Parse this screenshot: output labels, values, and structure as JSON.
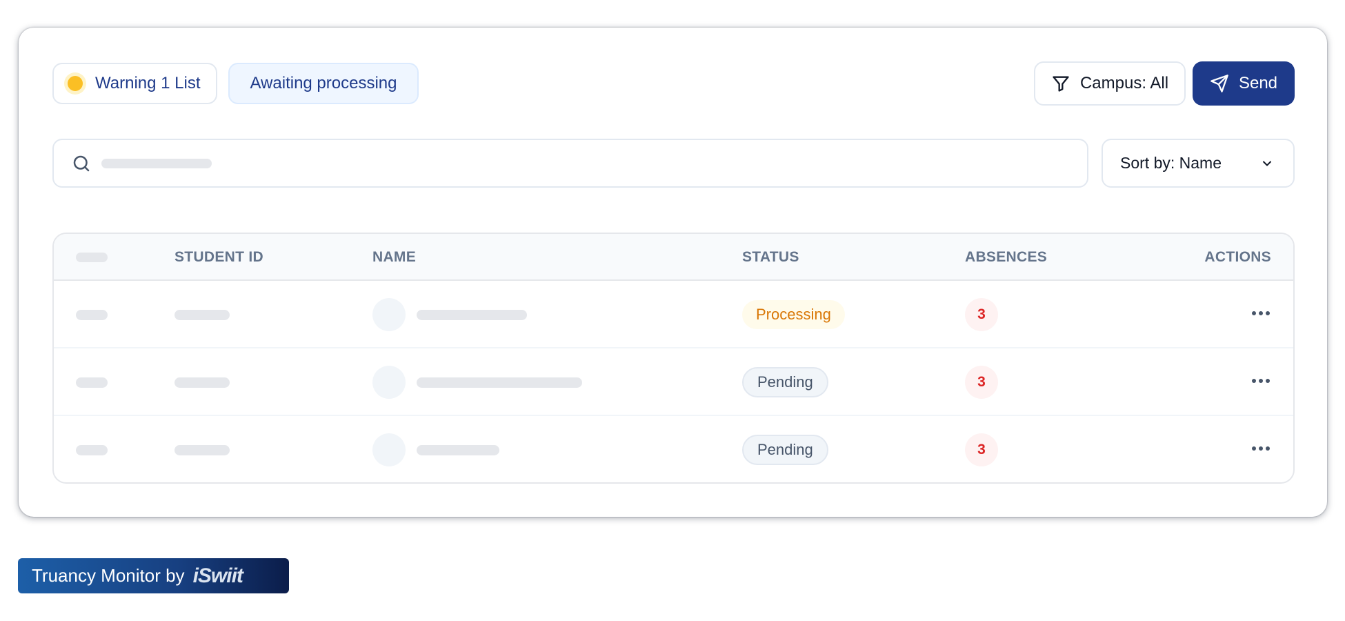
{
  "header": {
    "warning_chip": "Warning 1 List",
    "awaiting_chip": "Awaiting processing",
    "campus_button": "Campus: All",
    "send_button": "Send"
  },
  "search": {
    "placeholder": ""
  },
  "sort": {
    "label": "Sort by: Name"
  },
  "table": {
    "columns": {
      "student_id": "STUDENT ID",
      "name": "NAME",
      "status": "STATUS",
      "absences": "ABSENCES",
      "actions": "ACTIONS"
    },
    "rows": [
      {
        "status": "Processing",
        "absences": "3"
      },
      {
        "status": "Pending",
        "absences": "3"
      },
      {
        "status": "Pending",
        "absences": "3"
      }
    ]
  },
  "footer": {
    "brand_text": "Truancy Monitor by",
    "brand_logo": "iSwiit"
  },
  "colors": {
    "primary": "#1e3a8a",
    "warning_dot": "#fbbf24",
    "processing": "#d97706",
    "absence": "#dc2626"
  },
  "icons": [
    "filter-icon",
    "send-icon",
    "search-icon",
    "chevron-down-icon",
    "more-icon"
  ]
}
